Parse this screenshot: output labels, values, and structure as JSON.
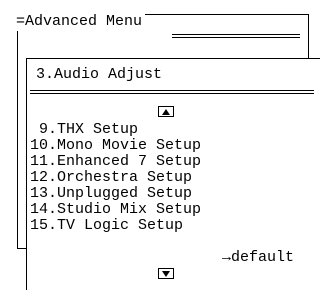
{
  "outer_window": {
    "title": "=Advanced Menu"
  },
  "inner_window": {
    "title": "3.Audio Adjust",
    "scroll_up_icon": "up-arrow",
    "scroll_down_icon": "down-arrow",
    "items": [
      " 9.THX Setup",
      "10.Mono Movie Setup",
      "11.Enhanced 7 Setup",
      "12.Orchestra Setup",
      "13.Unplugged Setup",
      "14.Studio Mix Setup",
      "15.TV Logic Setup"
    ],
    "default_label": "→default"
  }
}
